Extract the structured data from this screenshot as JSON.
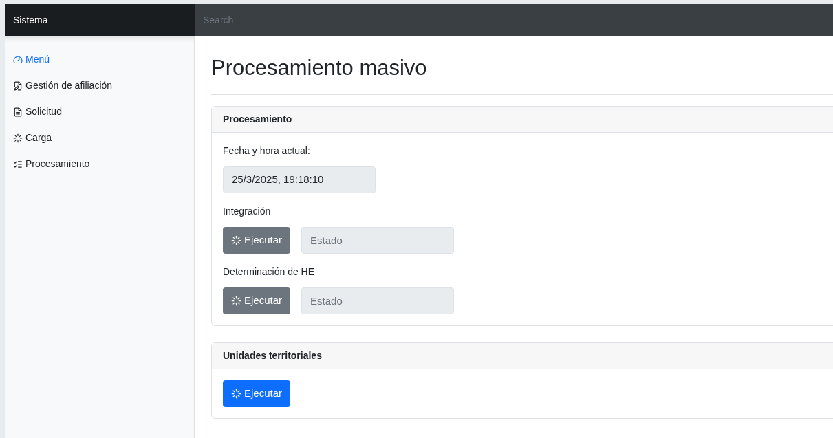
{
  "navbar": {
    "brand": "Sistema",
    "search": {
      "placeholder": "Search"
    }
  },
  "sidebar": {
    "items": [
      {
        "label": "Menú",
        "selected": true
      },
      {
        "label": "Gestión de afiliación",
        "selected": false
      },
      {
        "label": "Solicitud",
        "selected": false
      },
      {
        "label": "Carga",
        "selected": false
      },
      {
        "label": "Procesamiento",
        "selected": false
      }
    ]
  },
  "page": {
    "title": "Procesamiento masivo"
  },
  "cards": [
    {
      "title": "Procesamiento",
      "date_label": "Fecha y hora actual:",
      "date_value": "25/3/2025, 19:18:10",
      "processes": [
        {
          "label": "Integración",
          "button": {
            "label": "Ejecutar",
            "kind": "secondary"
          },
          "status": {
            "placeholder": "Estado"
          }
        },
        {
          "label": "Determinación de HE",
          "button": {
            "label": "Ejecutar",
            "kind": "secondary"
          },
          "status": {
            "placeholder": "Estado"
          }
        }
      ]
    },
    {
      "title": "Unidades territoriales",
      "processes": [
        {
          "button": {
            "label": "Ejecutar",
            "kind": "primary"
          }
        }
      ]
    }
  ]
}
